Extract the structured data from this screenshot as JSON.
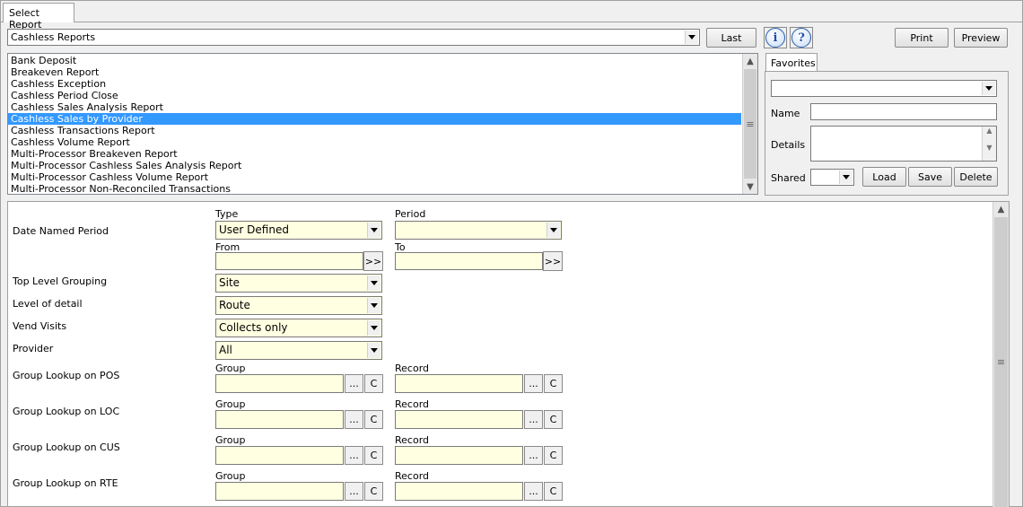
{
  "tab": {
    "label": "Select Report"
  },
  "report_category": {
    "value": "Cashless Reports"
  },
  "toolbar": {
    "last_label": "Last",
    "print_label": "Print",
    "preview_label": "Preview",
    "info_glyph": "i",
    "help_glyph": "?"
  },
  "reports": [
    "Bank Deposit",
    "Breakeven Report",
    "Cashless Exception",
    "Cashless Period Close",
    "Cashless Sales Analysis Report",
    "Cashless Sales by Provider",
    "Cashless Transactions Report",
    "Cashless Volume Report",
    "Multi-Processor Breakeven Report",
    "Multi-Processor Cashless Sales Analysis Report",
    "Multi-Processor Cashless Volume Report",
    "Multi-Processor Non-Reconciled Transactions"
  ],
  "selected_report": "Cashless Sales by Provider",
  "favorites": {
    "tab_label": "Favorites",
    "name_label": "Name",
    "details_label": "Details",
    "shared_label": "Shared",
    "load_label": "Load",
    "save_label": "Save",
    "delete_label": "Delete"
  },
  "params": {
    "date_named_period_label": "Date Named Period",
    "type_label": "Type",
    "type_value": "User Defined",
    "period_label": "Period",
    "period_value": "",
    "from_label": "From",
    "to_label": "To",
    "range_btn": ">>",
    "top_level_grouping_label": "Top Level Grouping",
    "top_level_grouping_value": "Site",
    "level_of_detail_label": "Level of detail",
    "level_of_detail_value": "Route",
    "vend_visits_label": "Vend Visits",
    "vend_visits_value": "Collects only",
    "provider_label": "Provider",
    "provider_value": "All",
    "group_label": "Group",
    "record_label": "Record",
    "ellipsis": "...",
    "clear": "C",
    "lookups": [
      {
        "label": "Group Lookup on POS"
      },
      {
        "label": "Group Lookup on LOC"
      },
      {
        "label": "Group Lookup on CUS"
      },
      {
        "label": "Group Lookup on RTE"
      }
    ]
  }
}
